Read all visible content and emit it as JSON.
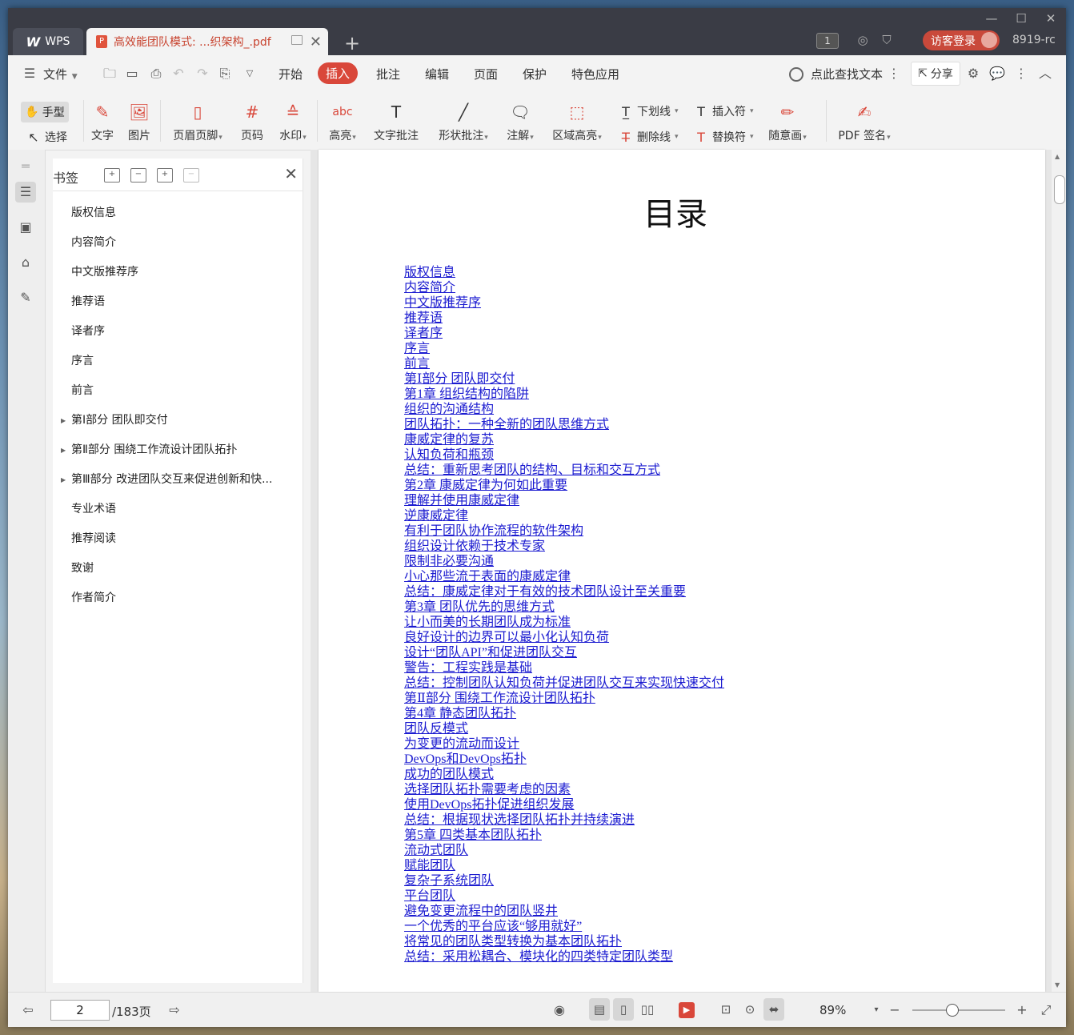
{
  "titlebar": {
    "app_tab": "WPS",
    "doc_tab": "高效能团队模式:  ...织架构_.pdf",
    "doc_count": "1",
    "login": "访客登录",
    "version": "8919-rc"
  },
  "menu": {
    "file": "文件",
    "items": [
      "开始",
      "插入",
      "批注",
      "编辑",
      "页面",
      "保护",
      "特色应用"
    ],
    "active": "插入",
    "search": "点此查找文本",
    "share": "分享"
  },
  "ribbon": {
    "hand": "手型",
    "select": "选择",
    "text": "文字",
    "image": "图片",
    "header_footer": "页眉页脚",
    "page_number": "页码",
    "watermark": "水印",
    "highlight": "高亮",
    "text_comment": "文字批注",
    "shape_comment": "形状批注",
    "note": "注解",
    "area_highlight": "区域高亮",
    "underline": "下划线",
    "strikethrough": "删除线",
    "insert_symbol": "插入符",
    "replace_symbol": "替换符",
    "freehand": "随意画",
    "pdf_sign": "PDF 签名"
  },
  "bookmarks": {
    "title": "书签",
    "items": [
      {
        "label": "版权信息",
        "expandable": false
      },
      {
        "label": "内容简介",
        "expandable": false
      },
      {
        "label": "中文版推荐序",
        "expandable": false
      },
      {
        "label": "推荐语",
        "expandable": false
      },
      {
        "label": "译者序",
        "expandable": false
      },
      {
        "label": "序言",
        "expandable": false
      },
      {
        "label": "前言",
        "expandable": false
      },
      {
        "label": "第Ⅰ部分 团队即交付",
        "expandable": true
      },
      {
        "label": "第Ⅱ部分 围绕工作流设计团队拓扑",
        "expandable": true
      },
      {
        "label": "第Ⅲ部分 改进团队交互来促进创新和快...",
        "expandable": true
      },
      {
        "label": "专业术语",
        "expandable": false
      },
      {
        "label": "推荐阅读",
        "expandable": false
      },
      {
        "label": "致谢",
        "expandable": false
      },
      {
        "label": "作者简介",
        "expandable": false
      }
    ]
  },
  "document": {
    "title": "目录",
    "toc": [
      "版权信息",
      "内容简介",
      "中文版推荐序",
      "推荐语",
      "译者序",
      "序言",
      "前言",
      "第Ⅰ部分 团队即交付",
      "第1章 组织结构的陷阱",
      "组织的沟通结构",
      "团队拓扑：一种全新的团队思维方式",
      "康威定律的复苏",
      "认知负荷和瓶颈",
      "总结：重新思考团队的结构、目标和交互方式",
      "第2章 康威定律为何如此重要",
      "理解并使用康威定律",
      "逆康威定律",
      "有利于团队协作流程的软件架构",
      "组织设计依赖于技术专家",
      "限制非必要沟通",
      "小心那些流于表面的康威定律",
      "总结：康威定律对于有效的技术团队设计至关重要",
      "第3章 团队优先的思维方式",
      "让小而美的长期团队成为标准",
      "良好设计的边界可以最小化认知负荷",
      "设计“团队API”和促进团队交互",
      "警告：工程实践是基础",
      "总结：控制团队认知负荷并促进团队交互来实现快速交付",
      "第Ⅱ部分 围绕工作流设计团队拓扑",
      "第4章 静态团队拓扑",
      "团队反模式",
      "为变更的流动而设计",
      "DevOps和DevOps拓扑",
      "成功的团队模式",
      "选择团队拓扑需要考虑的因素",
      "使用DevOps拓扑促进组织发展",
      "总结：根据现状选择团队拓扑并持续演进",
      "第5章 四类基本团队拓扑",
      "流动式团队",
      "赋能团队",
      "复杂子系统团队",
      "平台团队",
      "避免变更流程中的团队竖井",
      "一个优秀的平台应该“够用就好”",
      "将常见的团队类型转换为基本团队拓扑",
      "总结：采用松耦合、模块化的四类特定团队类型"
    ]
  },
  "status": {
    "current_page": "2",
    "total_pages": "/183页",
    "zoom": "89%"
  }
}
